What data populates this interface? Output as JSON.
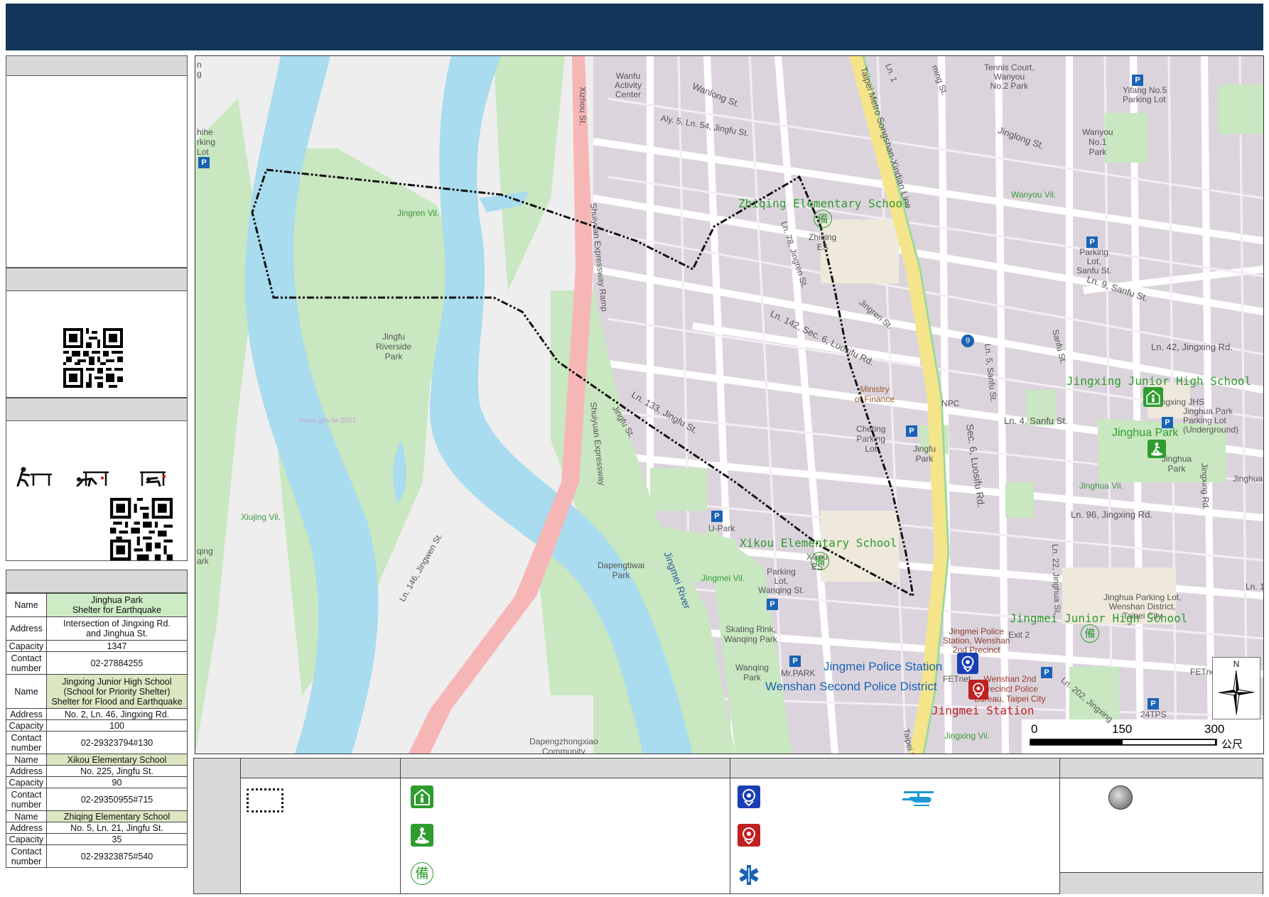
{
  "map": {
    "places": {
      "wanfu_center": [
        "Wanfu",
        "Activity",
        "Center"
      ],
      "wanlong_st": "Wanlong St.",
      "aly5": "Aly. 5, Ln. 54, Jingfu St.",
      "xizhou_st": "Xizhou St.",
      "metro": "Taipei Metro Songshan-Xindian Line",
      "tennis": [
        "Tennis Court,",
        "Wanyou",
        "No.2 Park"
      ],
      "yifang": [
        "Yifang No.5",
        "Parking Lot"
      ],
      "jinglong_st": "Jinglong St.",
      "wanyou_park": [
        "Wanyou",
        "No.1",
        "Park"
      ],
      "wanyou_vil": "Wanyou Vil.",
      "parking_sanfu": [
        "Parking",
        "Lot,",
        "Sanfu St."
      ],
      "ln9_sanfu": "Ln. 9, Sanfu St.",
      "ln42": "Ln. 42, Jingxing Rd.",
      "zhiqing_es": "Zhiqing Elementary School",
      "zhiqing_short": [
        "Zhiqing",
        "ES"
      ],
      "jingren_vil": "Jingren Vil.",
      "shuiyuan_ramp": "Shuiyuan Expressway Ramp",
      "shuiyuan_exp": "Shuiyuan Expressway",
      "ln78": "Ln. 78, Jingren St.",
      "jingren_st": "Jingren St.",
      "ln142": "Ln. 142, Sec. 6, Luosifu Rd.",
      "jingfu_riverside": [
        "Jingfu",
        "Riverside",
        "Park"
      ],
      "ministry": [
        "Ministry",
        "of Finance"
      ],
      "npc": "NPC",
      "cheting": [
        "Cheting",
        "Parking",
        "Lot"
      ],
      "jingfu_park": [
        "Jingfu",
        "Park"
      ],
      "ln133": "Ln. 133, Jingfu St.",
      "jingfu_st": "Jingfu St.",
      "sec6_luosifu": "Sec. 6, Luosifu Rd.",
      "ln5_sanfu": "Ln. 5, Sanfu St.",
      "sanfu_st": "Sanfu St.",
      "ln4_sanfu": "Ln. 4, Sanfu St.",
      "jingxing_jhs": "Jingxing Junior High School",
      "jingxing_short": "Jingxing JHS",
      "jinghua_parking": [
        "Jinghua Park",
        "Parking Lot",
        "(Underground)"
      ],
      "jinghua_park": "Jinghua Park",
      "jinghua_short": [
        "Jinghua",
        "Park"
      ],
      "jinghua_vil": "Jinghua Vil.",
      "jinghua_edge": "Jinghua",
      "jingxing_rd": "Jingxing Rd.",
      "ln96": "Ln. 96, Jingxing Rd.",
      "uPark": "U-Park",
      "xiujing_vil": "Xiujing Vil.",
      "dapengtiwai": [
        "Dapengtiwai",
        "Park"
      ],
      "jingmei_river": "Jingmei River",
      "xikou_es": "Xikou Elementary School",
      "xikou_short": [
        "Xikou",
        "ES"
      ],
      "jingmei_vil": "Jingmei Vil.",
      "parking_wanqing": [
        "Parking",
        "Lot,",
        "Wanqing St."
      ],
      "skating": [
        "Skating Rink,",
        "Wanqing Park"
      ],
      "wanqing_park": [
        "Wanqing",
        "Park"
      ],
      "mrpark": "Mr.PARK",
      "ln22": "Ln. 22, Jinghua St.",
      "jinghua_parking_ws": [
        "Jinghua Parking Lot,",
        "Wenshan District,",
        "Taipei City"
      ],
      "jingmei_jhs": "Jingmei Junior High School",
      "jingmei_police_small": [
        "Jingmei Police",
        "Station, Wenshan",
        "2nd Precinct"
      ],
      "exit2": "Exit 2",
      "fetnet": "FETnet",
      "fetnet2": "FETnet",
      "police_bureau": [
        "Wenshan 2nd",
        "Precinct Police",
        "Bureau, Taipei City"
      ],
      "jingmei_police_big": "Jingmei Police Station",
      "wenshan_second": "Wenshan Second Police District",
      "jingmei_station": "Jingmei Station",
      "ln202": "Ln. 202, Jingxing",
      "tps": "24TPS",
      "ln146": "Ln. 146, Jingwen St.",
      "dapengzhongxiao": [
        "Dapengzhongxiao",
        "Community"
      ],
      "jingxing_vil": "Jingxing Vil.",
      "taipei_metro_bottom": "Taipei Metro",
      "watermark": "maps.gov.tw 2021",
      "edge_lt": [
        "hihe",
        "rking",
        "Lot"
      ],
      "edge_lb": [
        "qing",
        "ark"
      ],
      "edge_rt": "Jinghua",
      "edge_rm": "Ln. 1",
      "ming_st": "ming St.",
      "ln1": "Ln. 1",
      "gi": [
        "n",
        "g"
      ]
    },
    "scale": {
      "t0": "0",
      "t1": "150",
      "t2": "300",
      "unit": "公尺"
    },
    "north": "N",
    "shelter_char": "備",
    "metro_badge": "9"
  },
  "shelters": [
    {
      "label_name": "Name",
      "name": "Jinghua Park",
      "type": "Shelter for Earthquake",
      "label_address": "Address",
      "address": [
        "Intersection of Jingxing Rd.",
        "and Jinghua St."
      ],
      "label_capacity": "Capacity",
      "capacity": "1347",
      "label_contact": "Contact number",
      "contact": "02-27884255"
    },
    {
      "label_name": "Name",
      "name": "Jingxing Junior High School",
      "type": "(School for Priority Shelter)",
      "type2": "Shelter for Flood and Earthquake",
      "label_address": "Address",
      "address": [
        "No. 2, Ln. 46, Jingxing Rd."
      ],
      "label_capacity": "Capacity",
      "capacity": "100",
      "label_contact": "Contact number",
      "contact": "02-29323794#130"
    },
    {
      "label_name": "Name",
      "name": "Xikou Elementary School",
      "label_address": "Address",
      "address": [
        "No. 225, Jingfu St."
      ],
      "label_capacity": "Capacity",
      "capacity": "90",
      "label_contact": "Contact number",
      "contact": "02-29350955#715"
    },
    {
      "label_name": "Name",
      "name": "Zhiqing Elementary School",
      "label_address": "Address",
      "address": [
        "No. 5, Ln. 21, Jingfu St."
      ],
      "label_capacity": "Capacity",
      "capacity": "35",
      "label_contact": "Contact number",
      "contact": "02-29323875#540"
    }
  ],
  "colors": {
    "header": "#14365a",
    "river": "#a8dcee",
    "park": "#c9e7c0",
    "building": "#dcd4dd",
    "road": "#ffffff",
    "expressway": "#f7b6b6",
    "metro": "#f4e58a",
    "shelter_green": "#2e9c2e",
    "police_blue": "#1a63b5",
    "police_red": "#c02020"
  }
}
